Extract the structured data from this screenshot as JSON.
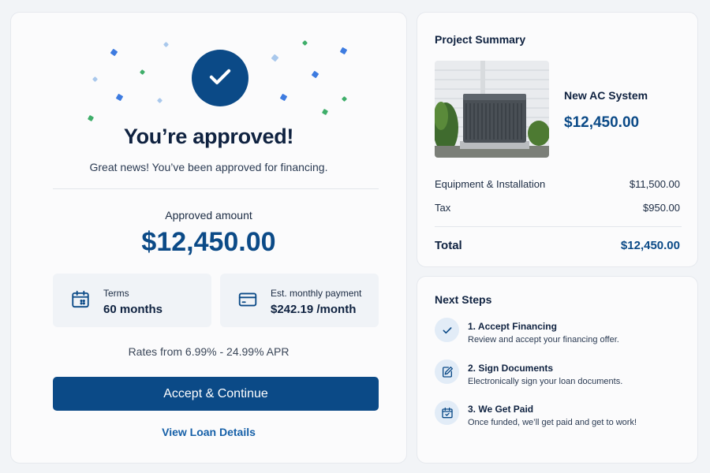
{
  "approval": {
    "headline": "You’re approved!",
    "subtitle": "Great news! You’ve been approved for financing.",
    "approved_label": "Approved amount",
    "approved_amount": "$12,450.00",
    "terms": {
      "label": "Terms",
      "value": "60 months",
      "icon": "calendar-icon"
    },
    "monthly": {
      "label": "Est. monthly payment",
      "value": "$242.19 /month",
      "icon": "credit-card-icon"
    },
    "rates": "Rates from 6.99% - 24.99% APR",
    "accept_label": "Accept & Continue",
    "details_label": "View Loan Details"
  },
  "summary": {
    "title": "Project Summary",
    "product_name": "New AC System",
    "product_price": "$12,450.00",
    "lines": [
      {
        "label": "Equipment & Installation",
        "value": "$11,500.00"
      },
      {
        "label": "Tax",
        "value": "$950.00"
      }
    ],
    "total_label": "Total",
    "total_value": "$12,450.00"
  },
  "next_steps": {
    "title": "Next Steps",
    "steps": [
      {
        "title": "1. Accept Financing",
        "desc": "Review and accept your financing offer.",
        "icon": "check-icon"
      },
      {
        "title": "2. Sign Documents",
        "desc": "Electronically sign your loan documents.",
        "icon": "sign-document-icon"
      },
      {
        "title": "3. We Get Paid",
        "desc": "Once funded, we’ll get paid and get to work!",
        "icon": "calendar-check-icon"
      }
    ]
  },
  "colors": {
    "brand": "#0b4a87",
    "background": "#f2f4f7",
    "confetti_blue": "#3d7be0",
    "confetti_green": "#3fae6a",
    "confetti_light": "#a9c8ec"
  }
}
